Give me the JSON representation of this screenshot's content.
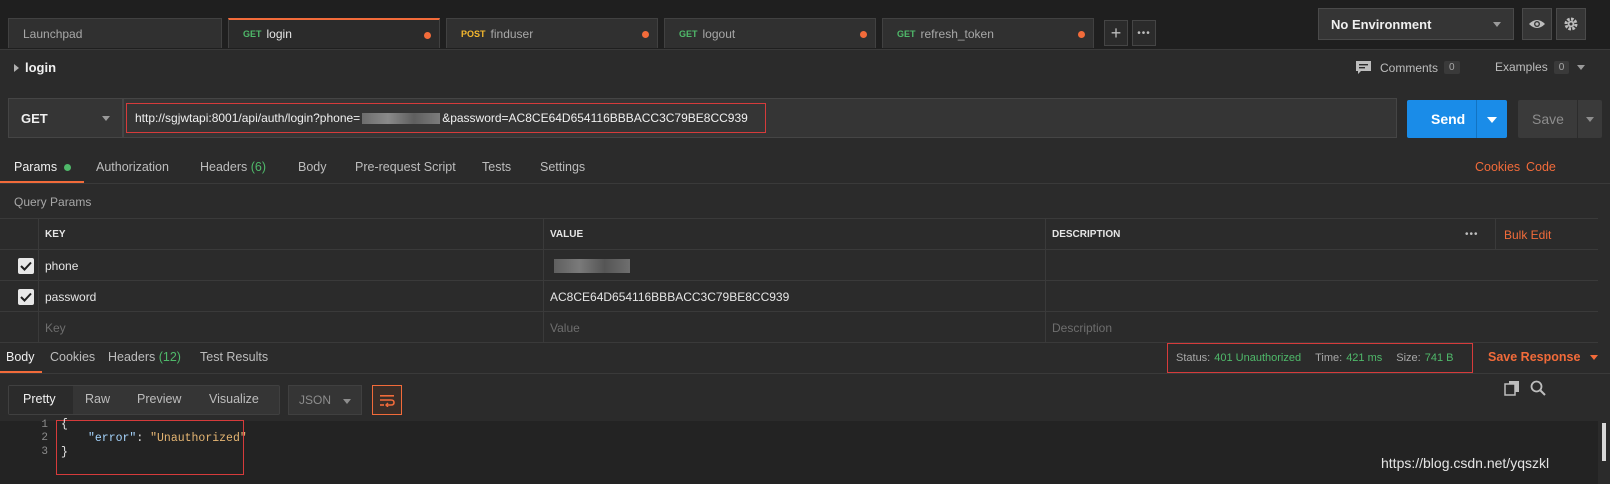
{
  "tabs": [
    {
      "label": "Launchpad",
      "method": "",
      "unsaved": false,
      "active": false
    },
    {
      "label": "login",
      "method": "GET",
      "unsaved": true,
      "active": true
    },
    {
      "label": "finduser",
      "method": "POST",
      "unsaved": true,
      "active": false
    },
    {
      "label": "logout",
      "method": "GET",
      "unsaved": true,
      "active": false
    },
    {
      "label": "refresh_token",
      "method": "GET",
      "unsaved": true,
      "active": false
    }
  ],
  "tab_actions": {
    "new_tab": "+",
    "more": "•••"
  },
  "environment": {
    "selected": "No Environment"
  },
  "request": {
    "name": "login",
    "comments_label": "Comments",
    "comments_count": "0",
    "examples_label": "Examples",
    "examples_count": "0",
    "method": "GET",
    "url_prefix": "http://sgjwtapi:8001/api/auth/login?phone=",
    "url_suffix": "&password=AC8CE64D654116BBBACC3C79BE8CC939",
    "send_label": "Send",
    "save_label": "Save"
  },
  "request_tabs": {
    "params": "Params",
    "authorization": "Authorization",
    "headers": "Headers",
    "headers_count": "(6)",
    "body": "Body",
    "prerequest": "Pre-request Script",
    "tests": "Tests",
    "settings": "Settings",
    "cookies": "Cookies",
    "code": "Code"
  },
  "query_params": {
    "title": "Query Params",
    "headers": {
      "key": "KEY",
      "value": "VALUE",
      "description": "DESCRIPTION"
    },
    "bulk_edit": "Bulk Edit",
    "more": "•••",
    "rows": [
      {
        "key": "phone",
        "value": "",
        "checked": true
      },
      {
        "key": "password",
        "value": "AC8CE64D654116BBBACC3C79BE8CC939",
        "checked": true
      }
    ],
    "placeholders": {
      "key": "Key",
      "value": "Value",
      "description": "Description"
    }
  },
  "response_tabs": {
    "body": "Body",
    "cookies": "Cookies",
    "headers": "Headers",
    "headers_count": "(12)",
    "test_results": "Test Results"
  },
  "response_status": {
    "status_label": "Status:",
    "status_value": "401 Unauthorized",
    "time_label": "Time:",
    "time_value": "421 ms",
    "size_label": "Size:",
    "size_value": "741 B",
    "save_response": "Save Response"
  },
  "body_view": {
    "modes": [
      "Pretty",
      "Raw",
      "Preview",
      "Visualize"
    ],
    "active_mode": "Pretty",
    "language": "JSON"
  },
  "response_body": {
    "line_numbers": [
      "1",
      "2",
      "3"
    ],
    "line1": "{",
    "key": "\"error\"",
    "colon": ": ",
    "value": "\"Unauthorized\"",
    "line3": "}"
  },
  "watermark": "https://blog.csdn.net/yqszkl",
  "colors": {
    "accent": "#f26b3a",
    "send": "#1a8ce8",
    "get": "#4fb96a",
    "post": "#f5b82e",
    "highlight_box": "#d63b3b"
  }
}
